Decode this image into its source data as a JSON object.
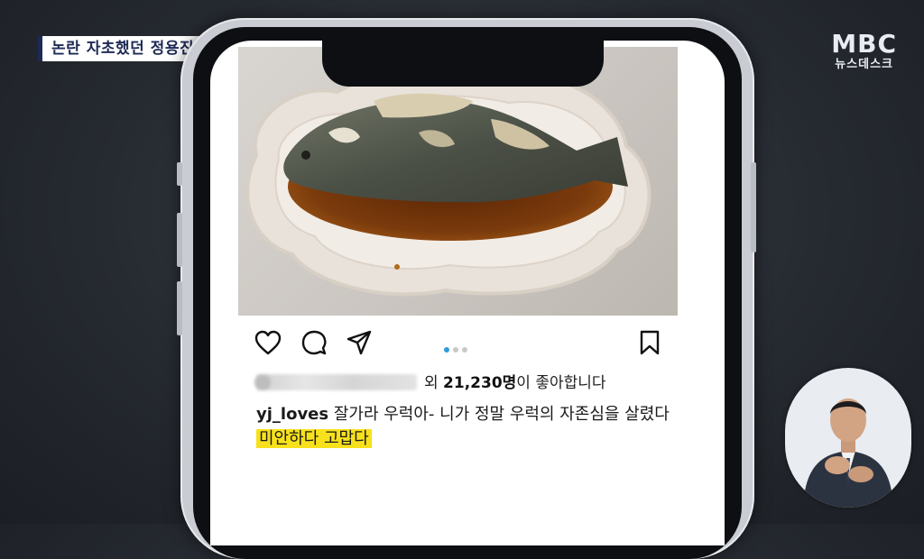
{
  "broadcast": {
    "caption": "논란 자초했던 정용진",
    "logo_main": "MBC",
    "logo_sub": "뉴스데스크"
  },
  "post": {
    "liked_by_prefix": "외",
    "like_count": "21,230명",
    "like_suffix": "이 좋아합니다",
    "username": "yj_loves",
    "caption_text": "잘가라 우럭아-  니가 정말 우럭의 자존심을 살렸다",
    "caption_highlight": "미안하다 고맙다",
    "carousel": {
      "count": 3,
      "active": 1
    }
  },
  "icons": [
    "heart-icon",
    "comment-icon",
    "share-icon",
    "bookmark-icon"
  ],
  "colors": {
    "highlight": "#f7e11c",
    "caption_text": "#1e2a55",
    "active_dot": "#2f9be0"
  }
}
